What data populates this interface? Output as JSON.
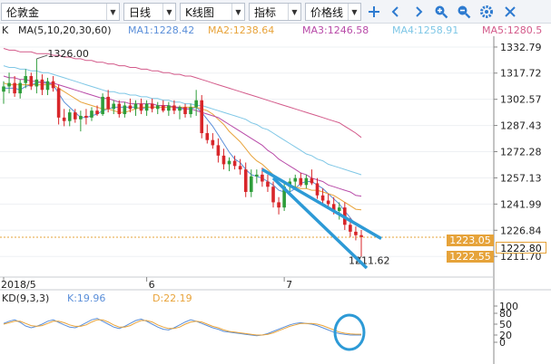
{
  "toolbar": {
    "symbol": "伦敦金",
    "period": "日线",
    "chart_type": "K线图",
    "indicator": "指标",
    "price_line": "价格线",
    "icons": [
      "crosshair-icon",
      "arrow-left-icon",
      "arrow-right-icon",
      "zoom-in-icon",
      "zoom-out-icon",
      "settings-icon",
      "close-icon"
    ]
  },
  "legend": {
    "k": "K",
    "ma_params": "MA(5,10,20,30,60)",
    "ma1": "MA1:1228.42",
    "ma2": "MA2:1238.64",
    "ma3": "MA3:1246.58",
    "ma4": "MA4:1258.91",
    "ma5": "MA5:1280.5"
  },
  "annotations": {
    "high": "1326.00",
    "low": "1211.62"
  },
  "price_tags": {
    "upper": "1223.05",
    "current": "1222.80",
    "lower": "1222.55"
  },
  "time_labels": [
    "2018/5",
    "6",
    "7"
  ],
  "kd": {
    "params": "KD(9,3,3)",
    "k": "K:19.96",
    "d": "D:22.19",
    "axis": [
      "100",
      "80",
      "50",
      "20",
      "0"
    ]
  },
  "colors": {
    "up": "#2e9d3a",
    "down": "#d8262a",
    "ma1": "#5b8fd9",
    "ma2": "#e8a33a",
    "ma3": "#b84aa8",
    "ma4": "#7fc7e6",
    "ma5": "#d35a8a",
    "trend": "#2d9ad6",
    "k_line": "#5b8fd9",
    "d_line": "#e8a33a",
    "price_tag": "#e6a33a"
  },
  "chart_data": {
    "type": "candlestick",
    "y_axis_ticks": [
      1332.79,
      1317.72,
      1302.57,
      1287.43,
      1272.28,
      1257.13,
      1241.99,
      1226.84,
      1211.7
    ],
    "ylim": [
      1205,
      1338
    ],
    "candles": [
      {
        "o": 1307,
        "h": 1313,
        "l": 1300,
        "c": 1310
      },
      {
        "o": 1310,
        "h": 1318,
        "l": 1306,
        "c": 1312
      },
      {
        "o": 1312,
        "h": 1316,
        "l": 1304,
        "c": 1306
      },
      {
        "o": 1306,
        "h": 1314,
        "l": 1303,
        "c": 1312
      },
      {
        "o": 1312,
        "h": 1320,
        "l": 1309,
        "c": 1316
      },
      {
        "o": 1316,
        "h": 1318,
        "l": 1308,
        "c": 1310
      },
      {
        "o": 1310,
        "h": 1326,
        "l": 1306,
        "c": 1314
      },
      {
        "o": 1314,
        "h": 1317,
        "l": 1305,
        "c": 1308
      },
      {
        "o": 1308,
        "h": 1315,
        "l": 1305,
        "c": 1313
      },
      {
        "o": 1313,
        "h": 1316,
        "l": 1307,
        "c": 1309
      },
      {
        "o": 1309,
        "h": 1311,
        "l": 1288,
        "c": 1292
      },
      {
        "o": 1292,
        "h": 1297,
        "l": 1287,
        "c": 1290
      },
      {
        "o": 1290,
        "h": 1297,
        "l": 1287,
        "c": 1295
      },
      {
        "o": 1295,
        "h": 1297,
        "l": 1289,
        "c": 1291
      },
      {
        "o": 1291,
        "h": 1296,
        "l": 1284,
        "c": 1293
      },
      {
        "o": 1293,
        "h": 1297,
        "l": 1288,
        "c": 1292
      },
      {
        "o": 1292,
        "h": 1298,
        "l": 1290,
        "c": 1296
      },
      {
        "o": 1296,
        "h": 1299,
        "l": 1293,
        "c": 1294
      },
      {
        "o": 1294,
        "h": 1306,
        "l": 1293,
        "c": 1304
      },
      {
        "o": 1304,
        "h": 1308,
        "l": 1295,
        "c": 1297
      },
      {
        "o": 1297,
        "h": 1302,
        "l": 1294,
        "c": 1300
      },
      {
        "o": 1300,
        "h": 1302,
        "l": 1292,
        "c": 1294
      },
      {
        "o": 1294,
        "h": 1301,
        "l": 1292,
        "c": 1299
      },
      {
        "o": 1299,
        "h": 1303,
        "l": 1295,
        "c": 1297
      },
      {
        "o": 1297,
        "h": 1302,
        "l": 1293,
        "c": 1300
      },
      {
        "o": 1300,
        "h": 1303,
        "l": 1294,
        "c": 1296
      },
      {
        "o": 1296,
        "h": 1302,
        "l": 1293,
        "c": 1300
      },
      {
        "o": 1300,
        "h": 1303,
        "l": 1295,
        "c": 1297
      },
      {
        "o": 1297,
        "h": 1301,
        "l": 1294,
        "c": 1299
      },
      {
        "o": 1299,
        "h": 1302,
        "l": 1295,
        "c": 1296
      },
      {
        "o": 1296,
        "h": 1301,
        "l": 1293,
        "c": 1299
      },
      {
        "o": 1299,
        "h": 1302,
        "l": 1294,
        "c": 1296
      },
      {
        "o": 1296,
        "h": 1299,
        "l": 1291,
        "c": 1298
      },
      {
        "o": 1298,
        "h": 1300,
        "l": 1292,
        "c": 1294
      },
      {
        "o": 1294,
        "h": 1300,
        "l": 1292,
        "c": 1298
      },
      {
        "o": 1298,
        "h": 1308,
        "l": 1293,
        "c": 1302
      },
      {
        "o": 1302,
        "h": 1305,
        "l": 1280,
        "c": 1283
      },
      {
        "o": 1283,
        "h": 1288,
        "l": 1277,
        "c": 1279
      },
      {
        "o": 1279,
        "h": 1283,
        "l": 1274,
        "c": 1276
      },
      {
        "o": 1276,
        "h": 1280,
        "l": 1266,
        "c": 1270
      },
      {
        "o": 1270,
        "h": 1274,
        "l": 1262,
        "c": 1265
      },
      {
        "o": 1265,
        "h": 1269,
        "l": 1261,
        "c": 1267
      },
      {
        "o": 1267,
        "h": 1270,
        "l": 1262,
        "c": 1264
      },
      {
        "o": 1264,
        "h": 1268,
        "l": 1259,
        "c": 1262
      },
      {
        "o": 1262,
        "h": 1266,
        "l": 1246,
        "c": 1249
      },
      {
        "o": 1249,
        "h": 1262,
        "l": 1246,
        "c": 1258
      },
      {
        "o": 1258,
        "h": 1262,
        "l": 1254,
        "c": 1259
      },
      {
        "o": 1259,
        "h": 1263,
        "l": 1252,
        "c": 1255
      },
      {
        "o": 1255,
        "h": 1259,
        "l": 1249,
        "c": 1252
      },
      {
        "o": 1252,
        "h": 1255,
        "l": 1240,
        "c": 1243
      },
      {
        "o": 1243,
        "h": 1246,
        "l": 1236,
        "c": 1240
      },
      {
        "o": 1240,
        "h": 1255,
        "l": 1238,
        "c": 1252
      },
      {
        "o": 1252,
        "h": 1257,
        "l": 1247,
        "c": 1255
      },
      {
        "o": 1255,
        "h": 1259,
        "l": 1251,
        "c": 1257
      },
      {
        "o": 1257,
        "h": 1260,
        "l": 1252,
        "c": 1253
      },
      {
        "o": 1253,
        "h": 1259,
        "l": 1251,
        "c": 1257
      },
      {
        "o": 1257,
        "h": 1262,
        "l": 1253,
        "c": 1254
      },
      {
        "o": 1254,
        "h": 1257,
        "l": 1245,
        "c": 1247
      },
      {
        "o": 1247,
        "h": 1251,
        "l": 1241,
        "c": 1244
      },
      {
        "o": 1244,
        "h": 1248,
        "l": 1240,
        "c": 1242
      },
      {
        "o": 1242,
        "h": 1246,
        "l": 1236,
        "c": 1238
      },
      {
        "o": 1238,
        "h": 1243,
        "l": 1233,
        "c": 1240
      },
      {
        "o": 1240,
        "h": 1243,
        "l": 1227,
        "c": 1230
      },
      {
        "o": 1230,
        "h": 1234,
        "l": 1223,
        "c": 1226
      },
      {
        "o": 1226,
        "h": 1229,
        "l": 1221,
        "c": 1224
      },
      {
        "o": 1224,
        "h": 1227,
        "l": 1211.62,
        "c": 1222.8
      }
    ],
    "moving_averages": [
      {
        "name": "MA1",
        "values": [
          1309,
          1309,
          1309,
          1308,
          1310,
          1311,
          1312,
          1313,
          1312,
          1311,
          1306,
          1301,
          1298,
          1295,
          1292,
          1292,
          1293,
          1294,
          1296,
          1297,
          1298,
          1298,
          1298,
          1298,
          1298,
          1297,
          1298,
          1298,
          1298,
          1298,
          1298,
          1298,
          1297,
          1297,
          1297,
          1298,
          1295,
          1291,
          1287,
          1282,
          1277,
          1272,
          1268,
          1266,
          1262,
          1259,
          1258,
          1257,
          1255,
          1253,
          1250,
          1249,
          1249,
          1251,
          1254,
          1255,
          1255,
          1253,
          1251,
          1248,
          1245,
          1242,
          1238,
          1234,
          1230,
          1228.42
        ]
      },
      {
        "name": "MA2",
        "values": [
          1312,
          1311,
          1311,
          1311,
          1311,
          1311,
          1311,
          1311,
          1311,
          1311,
          1309,
          1307,
          1305,
          1303,
          1301,
          1300,
          1299,
          1298,
          1297,
          1297,
          1296,
          1295,
          1295,
          1296,
          1297,
          1298,
          1298,
          1298,
          1298,
          1298,
          1298,
          1298,
          1298,
          1298,
          1298,
          1298,
          1297,
          1296,
          1294,
          1291,
          1288,
          1284,
          1281,
          1278,
          1274,
          1270,
          1267,
          1265,
          1262,
          1259,
          1256,
          1254,
          1253,
          1252,
          1251,
          1251,
          1250,
          1250,
          1249,
          1248,
          1247,
          1245,
          1243,
          1241,
          1239,
          1238.64
        ]
      },
      {
        "name": "MA3",
        "values": [
          1316,
          1315,
          1315,
          1314,
          1314,
          1313,
          1313,
          1312,
          1312,
          1312,
          1311,
          1310,
          1309,
          1308,
          1307,
          1306,
          1305,
          1304,
          1303,
          1303,
          1302,
          1301,
          1301,
          1300,
          1300,
          1300,
          1300,
          1300,
          1299,
          1299,
          1299,
          1298,
          1298,
          1297,
          1297,
          1296,
          1295,
          1294,
          1293,
          1292,
          1290,
          1288,
          1286,
          1284,
          1282,
          1280,
          1278,
          1276,
          1273,
          1271,
          1268,
          1266,
          1264,
          1262,
          1260,
          1259,
          1257,
          1256,
          1255,
          1253,
          1252,
          1251,
          1250,
          1249,
          1247,
          1246.58
        ]
      },
      {
        "name": "MA4",
        "values": [
          1322,
          1321,
          1321,
          1320,
          1320,
          1319,
          1319,
          1318,
          1318,
          1317,
          1316,
          1315,
          1314,
          1313,
          1312,
          1311,
          1310,
          1309,
          1308,
          1307,
          1307,
          1306,
          1306,
          1305,
          1305,
          1304,
          1304,
          1303,
          1303,
          1302,
          1302,
          1301,
          1301,
          1300,
          1300,
          1299,
          1299,
          1298,
          1297,
          1296,
          1295,
          1294,
          1293,
          1292,
          1291,
          1289,
          1288,
          1286,
          1285,
          1283,
          1281,
          1279,
          1277,
          1275,
          1273,
          1271,
          1270,
          1268,
          1267,
          1265,
          1264,
          1263,
          1262,
          1261,
          1260,
          1258.91
        ]
      },
      {
        "name": "MA5",
        "values": [
          1332,
          1331,
          1331,
          1330,
          1330,
          1330,
          1329,
          1329,
          1329,
          1328,
          1328,
          1327,
          1327,
          1326,
          1326,
          1325,
          1325,
          1324,
          1324,
          1323,
          1323,
          1322,
          1322,
          1321,
          1321,
          1320,
          1320,
          1319,
          1319,
          1318,
          1318,
          1317,
          1317,
          1316,
          1316,
          1315,
          1314,
          1313,
          1312,
          1311,
          1310,
          1309,
          1308,
          1307,
          1306,
          1305,
          1304,
          1303,
          1302,
          1301,
          1300,
          1299,
          1298,
          1297,
          1296,
          1295,
          1294,
          1293,
          1292,
          1291,
          1290,
          1289,
          1287,
          1285,
          1283,
          1280.5
        ]
      }
    ],
    "kd_series": [
      {
        "name": "K",
        "values": [
          52,
          58,
          62,
          55,
          45,
          40,
          44,
          50,
          58,
          62,
          55,
          48,
          42,
          40,
          46,
          54,
          62,
          66,
          58,
          50,
          42,
          38,
          44,
          52,
          60,
          64,
          58,
          50,
          42,
          36,
          34,
          40,
          48,
          56,
          62,
          58,
          52,
          46,
          40,
          36,
          30,
          28,
          26,
          24,
          22,
          20,
          18,
          20,
          24,
          30,
          36,
          42,
          48,
          52,
          54,
          52,
          50,
          46,
          40,
          34,
          28,
          24,
          22,
          20,
          19.96,
          19.96
        ]
      },
      {
        "name": "D",
        "values": [
          50,
          54,
          58,
          58,
          52,
          46,
          44,
          46,
          52,
          58,
          58,
          54,
          48,
          44,
          44,
          48,
          56,
          62,
          62,
          56,
          48,
          42,
          42,
          46,
          54,
          60,
          60,
          56,
          48,
          42,
          38,
          38,
          42,
          50,
          56,
          58,
          56,
          50,
          44,
          40,
          34,
          30,
          28,
          26,
          24,
          22,
          20,
          20,
          22,
          26,
          32,
          38,
          44,
          48,
          52,
          52,
          52,
          50,
          46,
          40,
          34,
          28,
          25,
          23,
          22.19,
          22.19
        ]
      }
    ],
    "kd_ylim": [
      0,
      100
    ]
  }
}
